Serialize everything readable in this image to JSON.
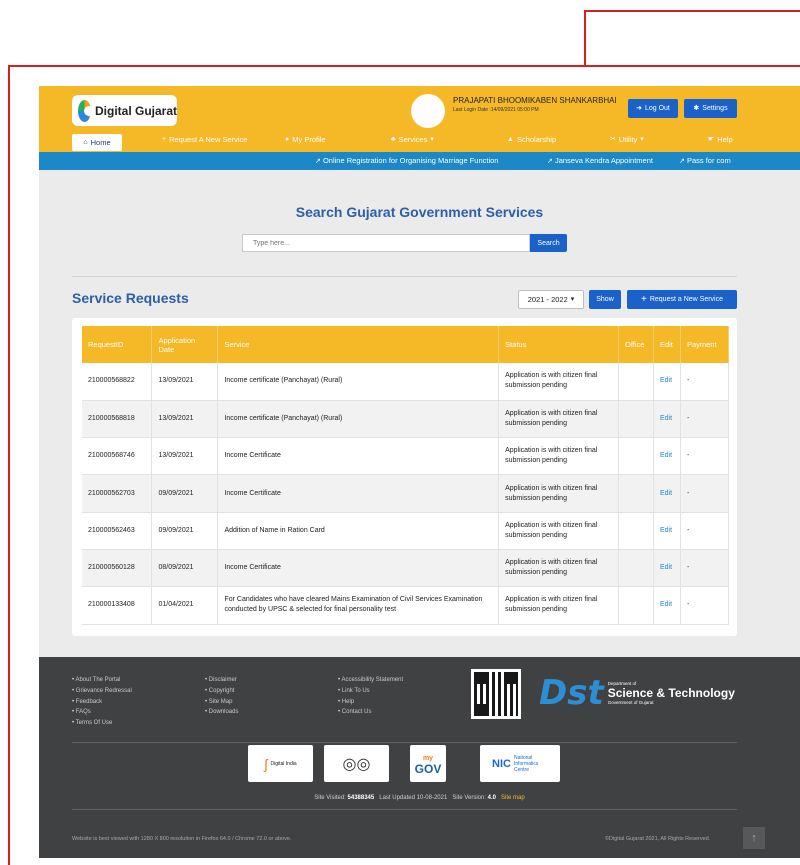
{
  "header": {
    "logo_text": "Digital Gujarat",
    "user_name": "PRAJAPATI BHOOMIKABEN SHANKARBHAI",
    "last_login": "Last Login Date :14/09/2021 05:00 PM",
    "logout_label": "Log Out",
    "settings_label": "Settings"
  },
  "nav": {
    "items": [
      "Home",
      "Request A New Service",
      "My Profile",
      "Services",
      "Scholarship",
      "Utility",
      "Help"
    ]
  },
  "announcements": [
    "Online Registration for Organising Marriage Function",
    "Janseva Kendra Appointment",
    "Pass for com"
  ],
  "search": {
    "title": "Search Gujarat Government Services",
    "placeholder": "Type here...",
    "button": "Search"
  },
  "service_requests": {
    "title": "Service Requests",
    "year": "2021 - 2022",
    "show_label": "Show",
    "request_label": "Request a New Service",
    "columns": [
      "RequestID",
      "Application Date",
      "Service",
      "Status",
      "Office",
      "Edit",
      "Payment"
    ],
    "rows": [
      {
        "id": "210000568822",
        "date": "13/09/2021",
        "service": "Income certificate (Panchayat) (Rural)",
        "status": "Application is with citizen final submission pending",
        "office": "",
        "edit": "Edit",
        "payment": "-"
      },
      {
        "id": "210000568818",
        "date": "13/09/2021",
        "service": "Income certificate (Panchayat) (Rural)",
        "status": "Application is with citizen final submission pending",
        "office": "",
        "edit": "Edit",
        "payment": "-"
      },
      {
        "id": "210000568746",
        "date": "13/09/2021",
        "service": "Income Certificate",
        "status": "Application is with citizen final submission pending",
        "office": "",
        "edit": "Edit",
        "payment": "-"
      },
      {
        "id": "210000562703",
        "date": "09/09/2021",
        "service": "Income Certificate",
        "status": "Application is with citizen final submission pending",
        "office": "",
        "edit": "Edit",
        "payment": "-"
      },
      {
        "id": "210000562463",
        "date": "09/09/2021",
        "service": "Addition of Name in Ration Card",
        "status": "Application is with citizen final submission pending",
        "office": "",
        "edit": "Edit",
        "payment": "-"
      },
      {
        "id": "210000560128",
        "date": "08/09/2021",
        "service": "Income Certificate",
        "status": "Application is with citizen final submission pending",
        "office": "",
        "edit": "Edit",
        "payment": "-"
      },
      {
        "id": "210000133408",
        "date": "01/04/2021",
        "service": "For Candidates who have cleared Mains Examination of Civil Services Examination conducted by UPSC & selected for final personality test",
        "status": "Application is with citizen final submission pending",
        "office": "",
        "edit": "Edit",
        "payment": "-"
      }
    ]
  },
  "footer": {
    "col1": [
      "About The Portal",
      "Grievance Redressal",
      "Feedback",
      "FAQs",
      "Terms Of Use"
    ],
    "col2": [
      "Disclaimer",
      "Copyright",
      "Site Map",
      "Downloads"
    ],
    "col3": [
      "Accessibility Statement",
      "Link To Us",
      "Help",
      "Contact Us"
    ],
    "dst": {
      "mark": "Dst",
      "dept": "Department of",
      "name": "Science & Technology",
      "gov": "Government of Gujarat"
    },
    "partners": {
      "digital_india": "Digital India",
      "mygov_top": "my",
      "mygov_main": "GOV",
      "nic": "NIC",
      "nic_sub": "National Informatics Centre"
    },
    "visits_label": "Site Visited:",
    "visits_value": "54388345",
    "updated": "Last Updated 10-08-2021",
    "version_label": "Site Version:",
    "version_value": "4.0",
    "sitemap": "Site map",
    "note": "Website is best viewed with 1280 X 800 resolution in Firefox 64.0 / Chrome 72.0 or above.",
    "copyright": "©Digital Gujarat 2021, All Rights Reserved."
  }
}
